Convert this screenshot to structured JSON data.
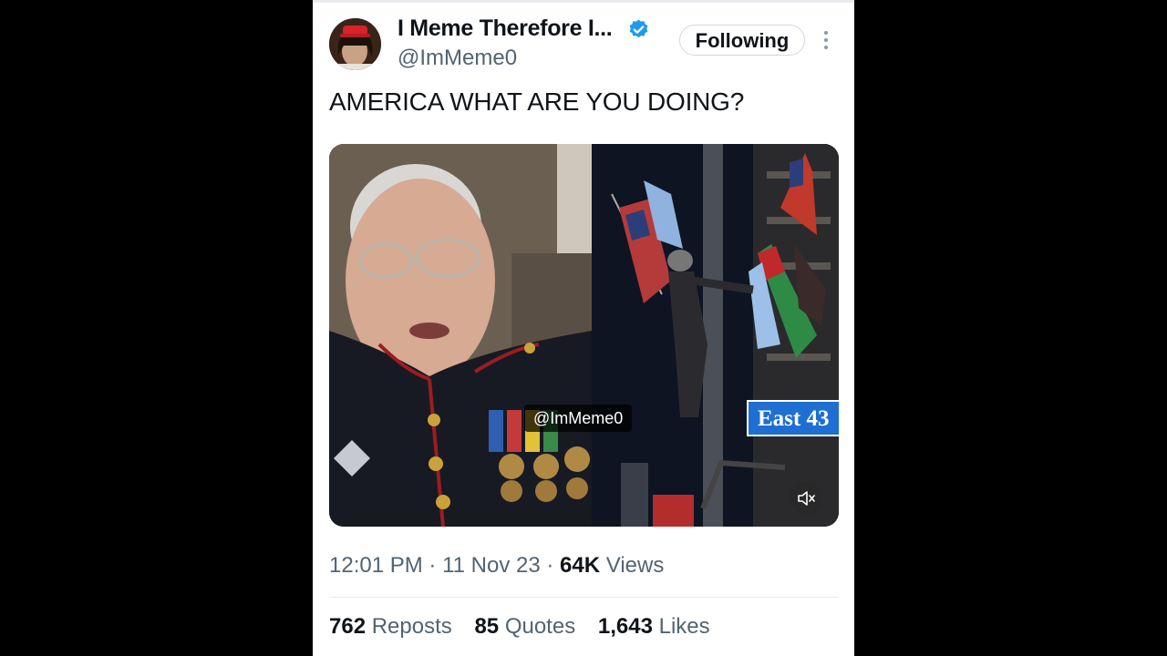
{
  "author": {
    "name": "I Meme Therefore I...",
    "handle": "@ImMeme0",
    "verified": true,
    "follow_label": "Following"
  },
  "tweet": {
    "text": "AMERICA WHAT ARE YOU DOING?",
    "media": {
      "watermark": "@ImMeme0",
      "street_sign": "East 43",
      "mute_icon": "muted-speaker-icon"
    },
    "time": "12:01 PM",
    "date": "11 Nov 23",
    "views_count": "64K",
    "views_label": "Views",
    "reposts_count": "762",
    "reposts_label": "Reposts",
    "quotes_count": "85",
    "quotes_label": "Quotes",
    "likes_count": "1,643",
    "likes_label": "Likes"
  },
  "colors": {
    "verified_blue": "#1d9bf0",
    "text_primary": "#0f1419",
    "text_secondary": "#536471"
  }
}
